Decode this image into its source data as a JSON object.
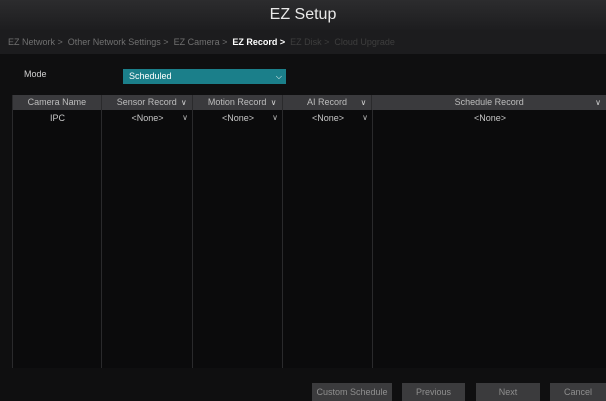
{
  "window": {
    "title": "EZ Setup"
  },
  "steps": [
    {
      "label": "EZ Network >"
    },
    {
      "label": "Other Network Settings >"
    },
    {
      "label": "EZ Camera >"
    },
    {
      "label": "EZ Record >"
    },
    {
      "label": "EZ Disk >"
    },
    {
      "label": "Cloud Upgrade"
    }
  ],
  "mode": {
    "label": "Mode",
    "value": "Scheduled"
  },
  "table": {
    "headers": [
      "Camera Name",
      "Sensor Record",
      "Motion Record",
      "AI Record",
      "Schedule Record"
    ],
    "rows": [
      {
        "camera": "IPC",
        "sensor": "<None>",
        "motion": "<None>",
        "ai": "<None>",
        "schedule": "<None>"
      }
    ]
  },
  "buttons": {
    "custom_schedule": "Custom Schedule",
    "previous": "Previous",
    "next": "Next",
    "cancel": "Cancel"
  },
  "colors": {
    "accent": "#1b7f8a",
    "background": "#0f0f10",
    "header": "#3a3a3d"
  }
}
